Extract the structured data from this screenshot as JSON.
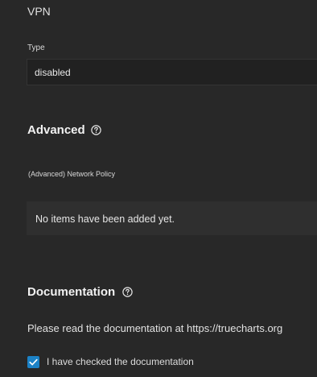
{
  "vpn": {
    "title": "VPN",
    "type_label": "Type",
    "type_value": "disabled"
  },
  "advanced": {
    "heading": "Advanced",
    "help_icon": "help-circle-icon",
    "network_policy_label": "(Advanced) Network Policy",
    "empty_text": "No items have been added yet."
  },
  "documentation": {
    "heading": "Documentation",
    "help_icon": "help-circle-icon",
    "text": "Please read the documentation at https://truecharts.org",
    "checkbox_label": "I have checked the documentation",
    "checkbox_checked": true,
    "checkbox_color": "#1c82c6"
  }
}
